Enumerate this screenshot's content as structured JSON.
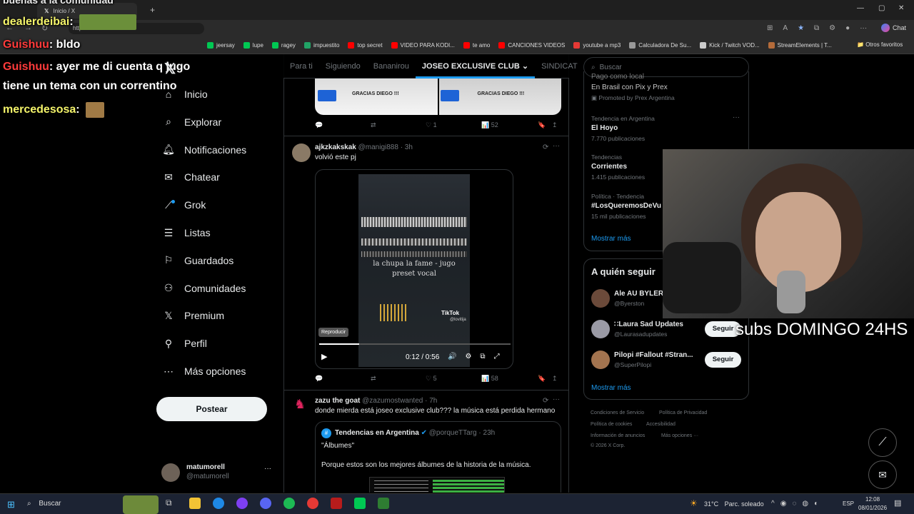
{
  "browser": {
    "tab_title": "Inicio / X",
    "url_text": "http",
    "new_tab": "+",
    "bookmarks": [
      {
        "label": "jeersay",
        "color": "#00c853"
      },
      {
        "label": "lupe",
        "color": "#00c853"
      },
      {
        "label": "ragey",
        "color": "#00c853"
      },
      {
        "label": "impuestito",
        "color": "#21a366"
      },
      {
        "label": "top secret",
        "color": "#ff0000"
      },
      {
        "label": "VIDEO PARA KODI...",
        "color": "#ff0000"
      },
      {
        "label": "te amo",
        "color": "#ff0000"
      },
      {
        "label": "CANCIONES VIDEOS",
        "color": "#ff0000"
      },
      {
        "label": "youtube a mp3",
        "color": "#e53935"
      },
      {
        "label": "Calculadora De Su...",
        "color": "#999999"
      },
      {
        "label": "Kick / Twitch VOD...",
        "color": "#cccccc"
      },
      {
        "label": "StreamElements | T...",
        "color": "#b46b3a"
      }
    ],
    "other_favorites": "Otros favoritos",
    "chat_label": "Chat"
  },
  "stream_chat": {
    "top_partial": "bueñas a la comunidad",
    "messages": [
      {
        "user": "dealerdeibai",
        "sep": ":",
        "text": ""
      },
      {
        "user": "Guishuu",
        "sep": ":",
        "text": "bldo"
      },
      {
        "user": "Guishuu",
        "sep": ":",
        "text": "ayer me di cuenta q jugo"
      },
      {
        "user": "",
        "sep": "",
        "text": "tiene un tema con un correntino"
      },
      {
        "user": "mercedesosa",
        "sep": ":",
        "text": ""
      }
    ]
  },
  "sidebar": {
    "items": [
      {
        "label": "Inicio",
        "icon": "home-icon"
      },
      {
        "label": "Explorar",
        "icon": "search-icon"
      },
      {
        "label": "Notificaciones",
        "icon": "bell-icon"
      },
      {
        "label": "Chatear",
        "icon": "mail-icon"
      },
      {
        "label": "Grok",
        "icon": "grok-icon"
      },
      {
        "label": "Listas",
        "icon": "list-icon"
      },
      {
        "label": "Guardados",
        "icon": "bookmark-icon"
      },
      {
        "label": "Comunidades",
        "icon": "people-icon"
      },
      {
        "label": "Premium",
        "icon": "x-logo-icon"
      },
      {
        "label": "Perfil",
        "icon": "person-icon"
      },
      {
        "label": "Más opciones",
        "icon": "more-circle-icon"
      }
    ],
    "post_button": "Postear",
    "account": {
      "name": "matumorell",
      "handle": "@matumorell",
      "more": "···"
    }
  },
  "feed": {
    "tabs": [
      "Para ti",
      "Siguiendo",
      "Bananirou",
      "JOSEO EXCLUSIVE CLUB",
      "SINDICAT"
    ],
    "active_tab": "JOSEO EXCLUSIVE CLUB",
    "top_post": {
      "image_captions": [
        "GRACIAS DIEGO !!!",
        "GRACIAS DIEGO !!!"
      ],
      "likes": "1",
      "views": "52"
    },
    "post1": {
      "name": "ajkzkakskak",
      "handle": "@manigi888",
      "time": "· 3h",
      "text": "volvió este pj",
      "video_caption_line1": "la chupa la fame - jugo",
      "video_caption_line2": "preset vocal",
      "tiktok": "TikTok",
      "tiktok_user": "@lovitija",
      "tooltip": "Reproducir",
      "time_display": "0:12 / 0:56",
      "progress": 0.21,
      "likes": "5",
      "views": "58"
    },
    "post2": {
      "name": "zazu the goat",
      "handle": "@zazumostwanted",
      "time": "· 7h",
      "text": "donde mierda está joseo exclusive club??? la música está perdida hermano",
      "quote": {
        "name": "Tendencias en Argentina",
        "handle": "@porqueTTarg",
        "time": "· 23h",
        "line1": "\"Álbumes\"",
        "line2": "Porque estos son los mejores álbumes de la historia de la música."
      }
    }
  },
  "right": {
    "search_placeholder": "Buscar",
    "promo": {
      "title": "Pago como local",
      "sub": "En Brasil con Pix y Prex",
      "promoted": "Promoted by Prex Argentina"
    },
    "trends": [
      {
        "context": "Tendencia en Argentina",
        "title": "El Hoyo",
        "count": "7.770 publicaciones"
      },
      {
        "context": "Tendencias",
        "title": "Corrientes",
        "count": "1.415 publicaciones"
      },
      {
        "context": "Política · Tendencia",
        "title": "#LosQueremosDeVu",
        "count": "15 mil publicaciones"
      }
    ],
    "show_more": "Mostrar más",
    "who_to_follow": "A quién seguir",
    "follow": [
      {
        "name": "Ale AU BYLER",
        "handle": "@Byerston",
        "button": ""
      },
      {
        "name": "∷Laura Sad Updates",
        "handle": "@Laurasadupdates",
        "button": "Seguir"
      },
      {
        "name": "Pilopi #Fallout #Stran...",
        "handle": "@SuperPilopi",
        "button": "Seguir"
      }
    ],
    "show_more2": "Mostrar más",
    "footer": {
      "l1a": "Condiciones de Servicio",
      "l1b": "Política de Privacidad",
      "l2a": "Política de cookies",
      "l2b": "Accesibilidad",
      "l3a": "Información de anuncios",
      "l3b": "Más opciones ···",
      "l4": "© 2026 X Corp."
    }
  },
  "overlay": {
    "subs_text": "subs DOMINGO 24HS"
  },
  "taskbar": {
    "search": "Buscar",
    "weather_temp": "31°C",
    "weather_text": "Parc. soleado",
    "lang": "ESP",
    "time": "12:08",
    "date": "08/01/2026"
  },
  "colors": {
    "accent": "#1d9bf0",
    "bg": "#000000",
    "border": "#2f3336",
    "muted": "#71767b",
    "text": "#e7e9ea",
    "chat_user": "#ff3b3b"
  }
}
